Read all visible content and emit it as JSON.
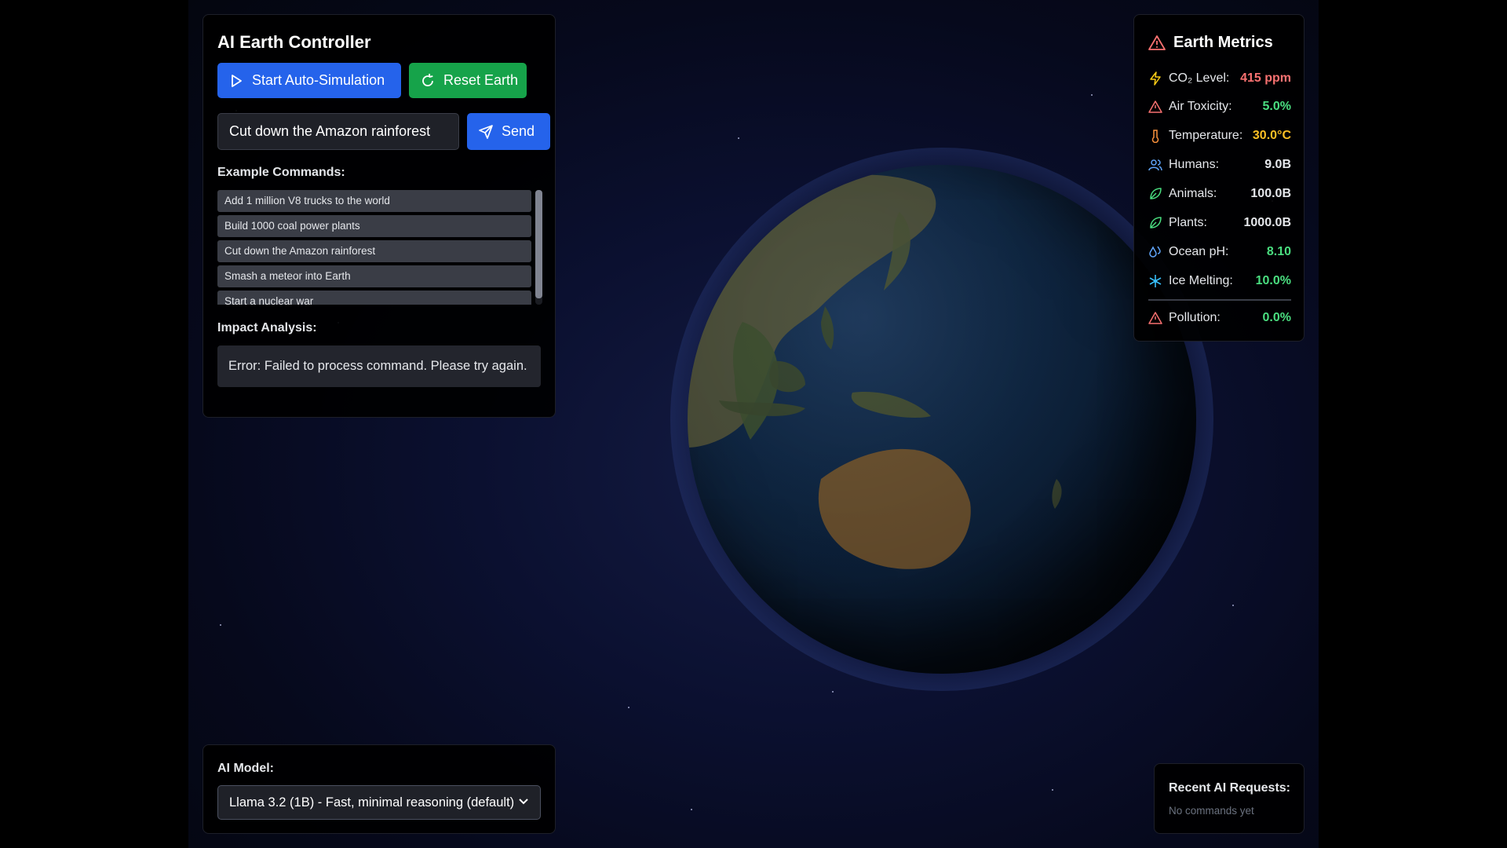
{
  "controller": {
    "title": "AI Earth Controller",
    "start_button_label": "Start Auto-Simulation",
    "reset_button_label": "Reset Earth",
    "command_value": "Cut down the Amazon rainforest",
    "send_button_label": "Send",
    "examples_heading": "Example Commands:",
    "examples": [
      "Add 1 million V8 trucks to the world",
      "Build 1000 coal power plants",
      "Cut down the Amazon rainforest",
      "Smash a meteor into Earth",
      "Start a nuclear war"
    ],
    "impact_heading": "Impact Analysis:",
    "impact_text": "Error: Failed to process command. Please try again."
  },
  "metrics": {
    "title": "Earth Metrics",
    "items": [
      {
        "label": "CO₂ Level:",
        "value": "415 ppm",
        "icon": "lightning-icon",
        "color": "#f87171"
      },
      {
        "label": "Air Toxicity:",
        "value": "5.0%",
        "icon": "warning-icon",
        "color": "#4ade80"
      },
      {
        "label": "Temperature:",
        "value": "30.0°C",
        "icon": "thermometer-icon",
        "color": "#fbbf24"
      },
      {
        "label": "Humans:",
        "value": "9.0B",
        "icon": "users-icon",
        "color": "#e5e7eb"
      },
      {
        "label": "Animals:",
        "value": "100.0B",
        "icon": "leaf-icon",
        "color": "#e5e7eb"
      },
      {
        "label": "Plants:",
        "value": "1000.0B",
        "icon": "leaf-icon",
        "color": "#e5e7eb"
      },
      {
        "label": "Ocean pH:",
        "value": "8.10",
        "icon": "droplets-icon",
        "color": "#4ade80"
      },
      {
        "label": "Ice Melting:",
        "value": "10.0%",
        "icon": "snowflake-icon",
        "color": "#4ade80"
      }
    ],
    "pollution": {
      "label": "Pollution:",
      "value": "0.0%",
      "icon": "warning-icon",
      "color": "#4ade80"
    }
  },
  "model": {
    "heading": "AI Model:",
    "selected": "Llama 3.2 (1B) - Fast, minimal reasoning (default)"
  },
  "recent": {
    "heading": "Recent AI Requests:",
    "empty_text": "No commands yet"
  },
  "colors": {
    "accent_blue": "#2563eb",
    "accent_green": "#16a34a",
    "warning_red": "#f87171"
  }
}
